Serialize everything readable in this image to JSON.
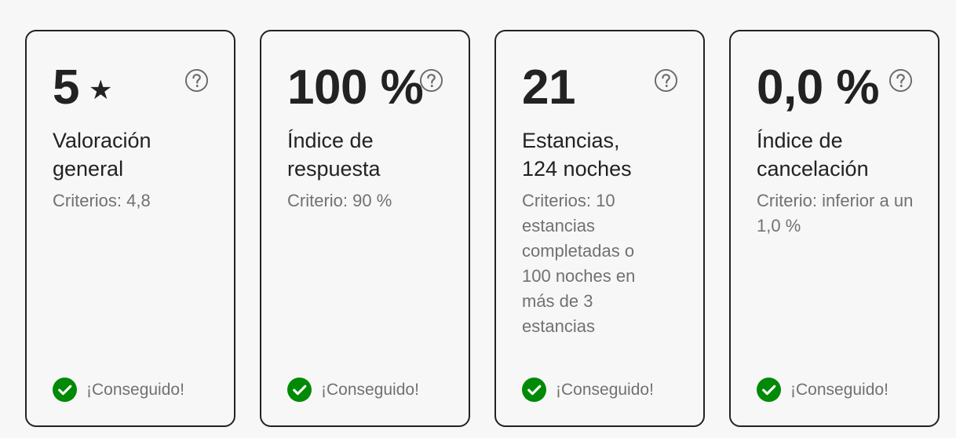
{
  "cards": [
    {
      "value": "5",
      "star_icon": "★",
      "title": "Valoración general",
      "criteria": "Criterios: 4,8",
      "status": "¡Conseguido!"
    },
    {
      "value": "100 %",
      "title": "Índice de respuesta",
      "criteria": "Criterio: 90 %",
      "status": "¡Conseguido!"
    },
    {
      "value": "21",
      "title": "Estancias, 124 noches",
      "criteria": "Criterios: 10 estancias completadas o 100 noches en más de 3 estancias",
      "status": "¡Conseguido!"
    },
    {
      "value": "0,0 %",
      "title": "Índice de cancelación",
      "criteria": "Criterio: inferior a un 1,0 %",
      "status": "¡Conseguido!"
    }
  ],
  "colors": {
    "success": "#008a05",
    "text": "#222222",
    "muted": "#717171",
    "border": "#222222",
    "background": "#f7f7f7"
  }
}
